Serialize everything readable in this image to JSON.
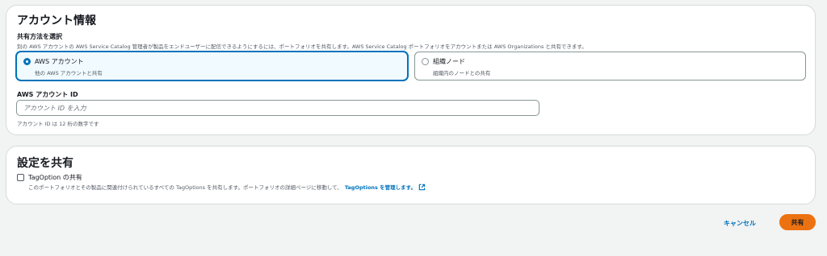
{
  "account_panel": {
    "title": "アカウント情報",
    "share_method": {
      "label": "共有方法を選択",
      "description": "別の AWS アカウントの AWS Service Catalog 管理者が製品をエンドユーザーに配信できるようにするには、ポートフォリオを共有します。AWS Service Catalog ポートフォリオをアカウントまたは AWS Organizations と共有できます。",
      "options": [
        {
          "label": "AWS アカウント",
          "description": "他の AWS アカウントと共有",
          "selected": true
        },
        {
          "label": "組織ノード",
          "description": "組織内のノードとの共有",
          "selected": false
        }
      ]
    },
    "account_id": {
      "label": "AWS アカウント ID",
      "placeholder": "アカウント ID を入力",
      "value": "",
      "hint": "アカウント ID は 12 桁の数字です"
    }
  },
  "share_settings_panel": {
    "title": "設定を共有",
    "tagoption": {
      "label": "TagOption の共有",
      "checked": false,
      "description": "このポートフォリオとその製品に関連付けられているすべての TagOptions を共有します。ポートフォリオの詳細ページに移動して、",
      "link_text": "TagOptions を管理します。",
      "link_icon": "external-link-icon"
    }
  },
  "actions": {
    "cancel_label": "キャンセル",
    "share_label": "共有"
  },
  "colors": {
    "accent": "#0073bb",
    "primary_button": "#ec7211",
    "selected_tile_bg": "#f1faff",
    "page_bg": "#f2f3f3"
  }
}
